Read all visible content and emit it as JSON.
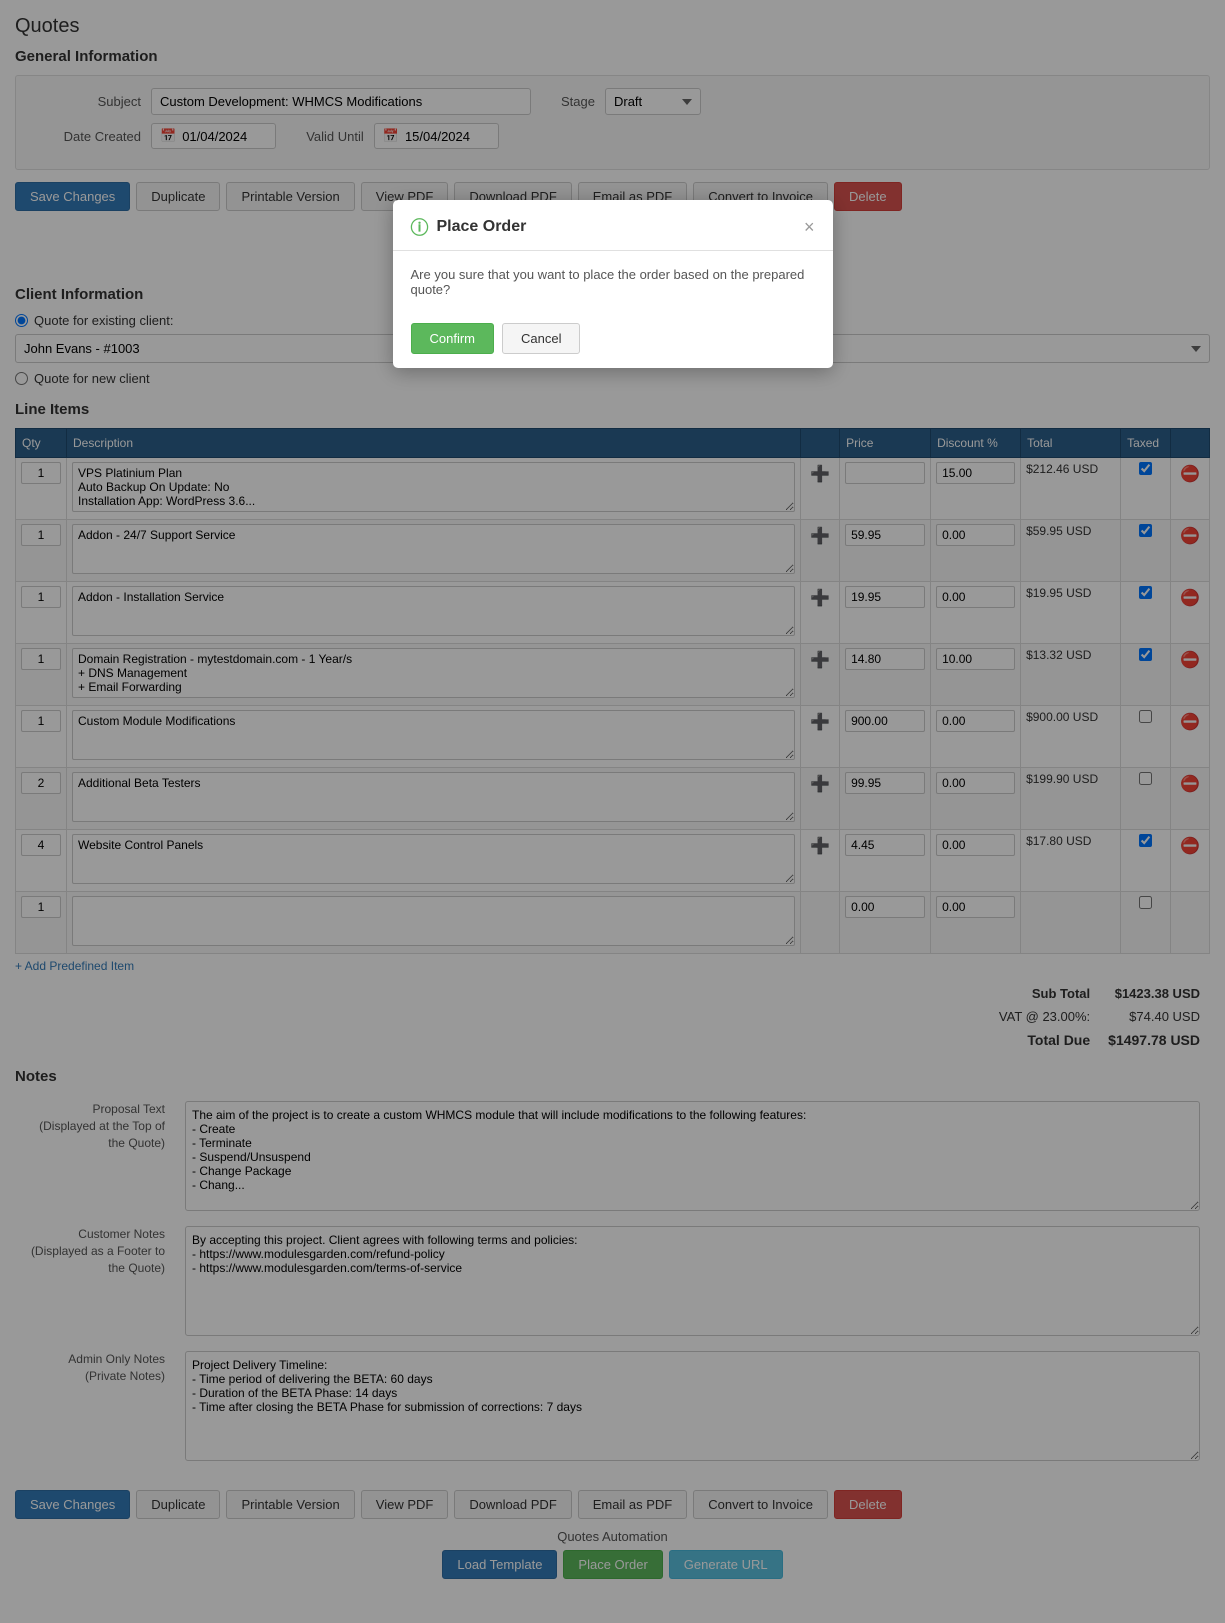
{
  "page": {
    "title": "Quotes",
    "section_general": "General Information",
    "section_client": "Client Information",
    "section_line_items": "Line Items",
    "section_notes": "Notes"
  },
  "general_info": {
    "subject_label": "Subject",
    "subject_value": "Custom Development: WHMCS Modifications",
    "stage_label": "Stage",
    "stage_value": "Draft",
    "date_created_label": "Date Created",
    "date_created_value": "01/04/2024",
    "valid_until_label": "Valid Until",
    "valid_until_value": "15/04/2024"
  },
  "toolbar": {
    "save_changes": "Save Changes",
    "duplicate": "Duplicate",
    "printable_version": "Printable Version",
    "view_pdf": "View PDF",
    "download_pdf": "Download PDF",
    "email_as_pdf": "Email as PDF",
    "convert_to_invoice": "Convert to Invoice",
    "delete": "Delete"
  },
  "automation": {
    "label": "Quotes Automation",
    "load_template": "Load Template",
    "place_order": "Place Order",
    "generate_url": "Generate URL"
  },
  "client": {
    "existing_label": "Quote for existing client:",
    "existing_value": "John Evans - #1003",
    "new_label": "Quote for new client"
  },
  "line_items": {
    "columns": [
      "Qty",
      "Description",
      "",
      "Price",
      "Discount %",
      "Total",
      "Taxed",
      ""
    ],
    "rows": [
      {
        "qty": "1",
        "description": "VPS Platinium Plan\nAuto Backup On Update: No\nInstallation App: WordPress 3.6...",
        "price": "",
        "discount": "15.00",
        "total": "$212.46 USD",
        "taxed": true
      },
      {
        "qty": "1",
        "description": "Addon - 24/7 Support Service",
        "price": "59.95",
        "discount": "0.00",
        "total": "$59.95 USD",
        "taxed": true
      },
      {
        "qty": "1",
        "description": "Addon - Installation Service",
        "price": "19.95",
        "discount": "0.00",
        "total": "$19.95 USD",
        "taxed": true
      },
      {
        "qty": "1",
        "description": "Domain Registration - mytestdomain.com - 1 Year/s\n+ DNS Management\n+ Email Forwarding",
        "price": "14.80",
        "discount": "10.00",
        "total": "$13.32 USD",
        "taxed": true
      },
      {
        "qty": "1",
        "description": "Custom Module Modifications",
        "price": "900.00",
        "discount": "0.00",
        "total": "$900.00 USD",
        "taxed": false
      },
      {
        "qty": "2",
        "description": "Additional Beta Testers",
        "price": "99.95",
        "discount": "0.00",
        "total": "$199.90 USD",
        "taxed": false
      },
      {
        "qty": "4",
        "description": "Website Control Panels",
        "price": "4.45",
        "discount": "0.00",
        "total": "$17.80 USD",
        "taxed": true
      },
      {
        "qty": "1",
        "description": "",
        "price": "0.00",
        "discount": "0.00",
        "total": "",
        "taxed": false
      }
    ],
    "add_item": "+ Add Predefined Item"
  },
  "totals": {
    "sub_total_label": "Sub Total",
    "sub_total_value": "$1423.38 USD",
    "vat_label": "VAT @ 23.00%:",
    "vat_value": "$74.40 USD",
    "total_due_label": "Total Due",
    "total_due_value": "$1497.78 USD"
  },
  "notes": {
    "proposal_label": "Proposal Text\n(Displayed at the Top of\nthe Quote)",
    "proposal_value": "The aim of the project is to create a custom WHMCS module that will include modifications to the following features:\n- Create\n- Terminate\n- Suspend/Unsuspend\n- Change Package\n- Chang...",
    "customer_label": "Customer Notes\n(Displayed as a Footer to\nthe Quote)",
    "customer_value": "By accepting this project. Client agrees with following terms and policies:\n- https://www.modulesgarden.com/refund-policy\n- https://www.modulesgarden.com/terms-of-service",
    "admin_label": "Admin Only Notes\n(Private Notes)",
    "admin_value": "Project Delivery Timeline:\n- Time period of delivering the BETA: 60 days\n- Duration of the BETA Phase: 14 days\n- Time after closing the BETA Phase for submission of corrections: 7 days"
  },
  "modal": {
    "title": "Place Order",
    "body": "Are you sure that you want to place the order based on the prepared quote?",
    "confirm": "Confirm",
    "cancel": "Cancel",
    "close_icon": "×"
  }
}
